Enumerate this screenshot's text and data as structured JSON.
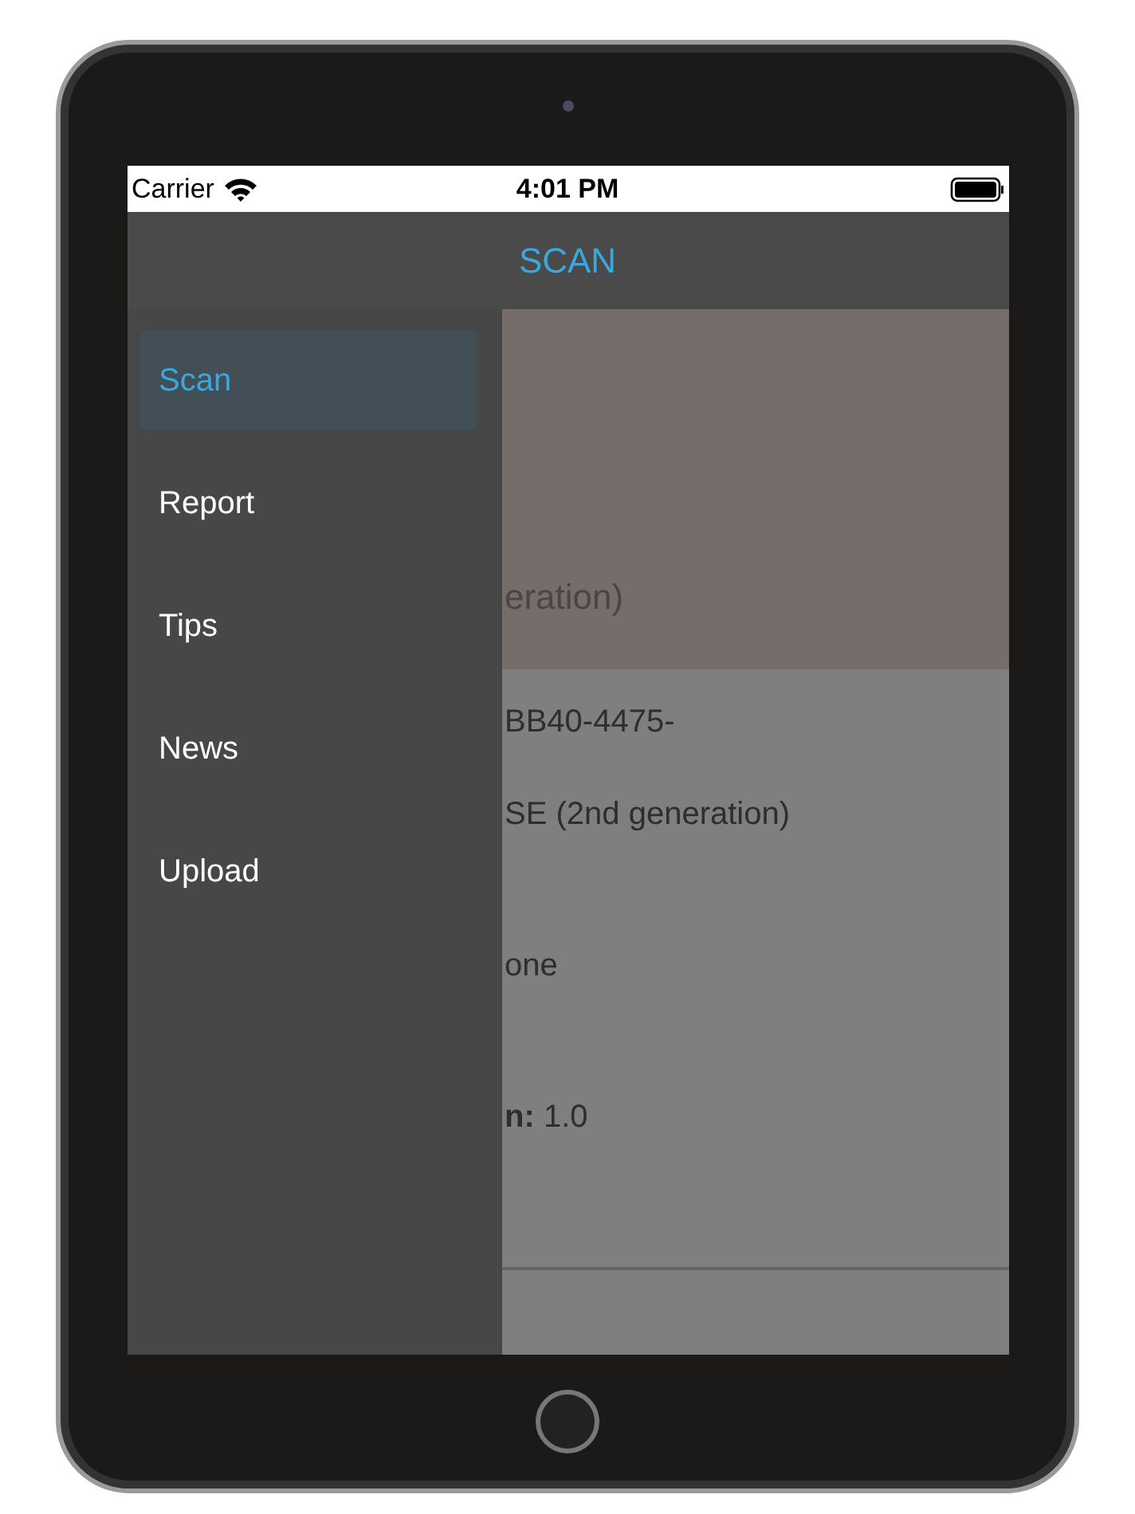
{
  "status_bar": {
    "carrier": "Carrier",
    "time": "4:01 PM"
  },
  "nav_bar": {
    "title": "SCAN"
  },
  "drawer": {
    "items": [
      {
        "label": "Scan",
        "selected": true
      },
      {
        "label": "Report",
        "selected": false
      },
      {
        "label": "Tips",
        "selected": false
      },
      {
        "label": "News",
        "selected": false
      },
      {
        "label": "Upload",
        "selected": false
      }
    ]
  },
  "content": {
    "header_text": "eration)",
    "lines": [
      "BB40-4475-",
      "SE (2nd generation)",
      "one",
      "**n:** 1.0"
    ]
  }
}
